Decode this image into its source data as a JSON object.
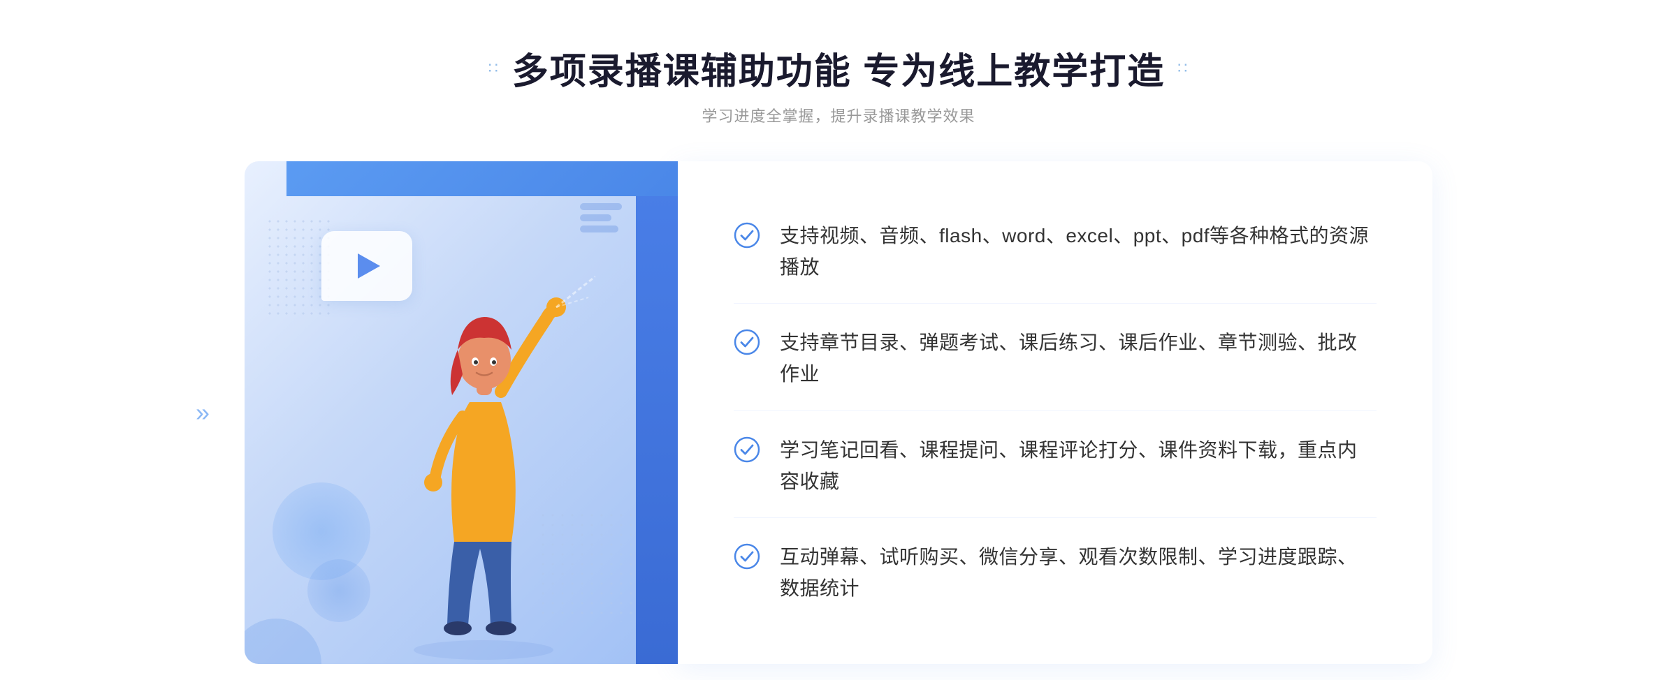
{
  "header": {
    "title": "多项录播课辅助功能 专为线上教学打造",
    "subtitle": "学习进度全掌握，提升录播课教学效果",
    "dots_left": "∷",
    "dots_right": "∷"
  },
  "features": [
    {
      "id": 1,
      "text": "支持视频、音频、flash、word、excel、ppt、pdf等各种格式的资源播放"
    },
    {
      "id": 2,
      "text": "支持章节目录、弹题考试、课后练习、课后作业、章节测验、批改作业"
    },
    {
      "id": 3,
      "text": "学习笔记回看、课程提问、课程评论打分、课件资料下载，重点内容收藏"
    },
    {
      "id": 4,
      "text": "互动弹幕、试听购买、微信分享、观看次数限制、学习进度跟踪、数据统计"
    }
  ],
  "colors": {
    "accent_blue": "#4a87e8",
    "light_blue": "#5b9bf2",
    "text_dark": "#333333",
    "text_gray": "#999999",
    "bg_white": "#ffffff"
  },
  "chevron_left": "»"
}
